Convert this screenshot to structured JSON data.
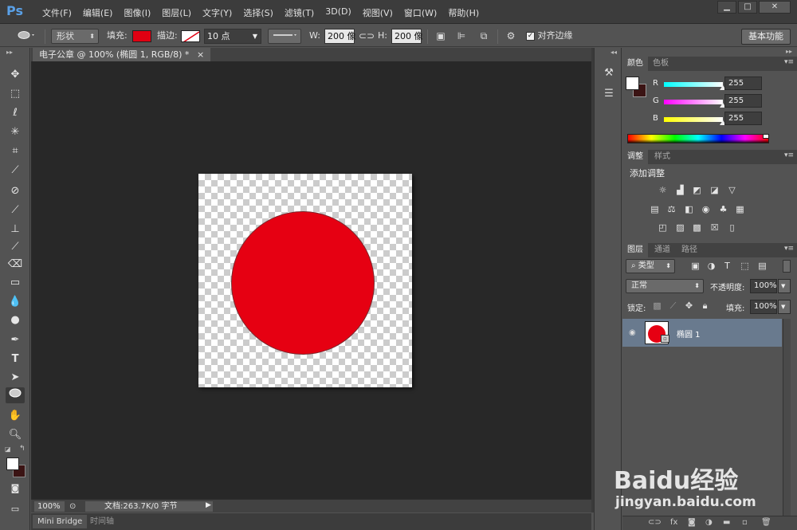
{
  "app": {
    "logo": "Ps"
  },
  "menu": [
    "文件(F)",
    "编辑(E)",
    "图像(I)",
    "图层(L)",
    "文字(Y)",
    "选择(S)",
    "滤镜(T)",
    "3D(D)",
    "视图(V)",
    "窗口(W)",
    "帮助(H)"
  ],
  "window_controls": {
    "minimize": "▁",
    "maximize": "□",
    "close": "✕"
  },
  "options": {
    "mode": "形状",
    "fill_label": "填充:",
    "stroke_label": "描边:",
    "stroke_width": "10 点",
    "w_label": "W:",
    "w_value": "200 像",
    "h_label": "H:",
    "h_value": "200 像",
    "align_edges": "对齐边缘",
    "workspace": "基本功能"
  },
  "document": {
    "tab_title": "电子公章 @ 100% (椭圆 1, RGB/8) *",
    "tab_close": "×",
    "fill_color": "#e60012"
  },
  "status": {
    "zoom": "100%",
    "doc_info": "文档:263.7K/0 字节"
  },
  "bottom_tabs": [
    "Mini Bridge",
    "时间轴"
  ],
  "color_panel": {
    "tabs": [
      "颜色",
      "色板"
    ],
    "channels": [
      {
        "label": "R",
        "value": "255"
      },
      {
        "label": "G",
        "value": "255"
      },
      {
        "label": "B",
        "value": "255"
      }
    ]
  },
  "adjust_panel": {
    "tabs": [
      "调整",
      "样式"
    ],
    "title": "添加调整"
  },
  "layers_panel": {
    "tabs": [
      "图层",
      "通道",
      "路径"
    ],
    "filter_kind": "类型",
    "blend_mode": "正常",
    "opacity_label": "不透明度:",
    "opacity": "100%",
    "lock_label": "锁定:",
    "fill_label": "填充:",
    "fill": "100%",
    "layer_name": "椭圆 1"
  },
  "watermark": {
    "brand": "Baidu经验",
    "url": "jingyan.baidu.com"
  }
}
